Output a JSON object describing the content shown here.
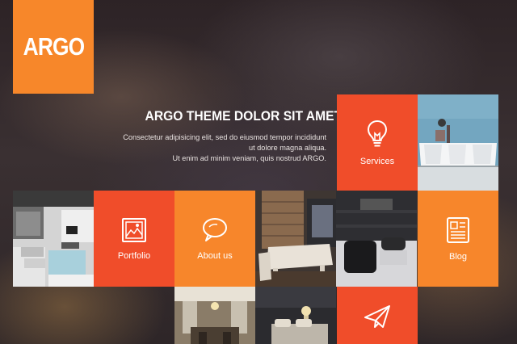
{
  "brand": {
    "logo_text": "ARGO"
  },
  "hero": {
    "title": "ARGO THEME DOLOR SIT AMET TELASDE",
    "lines": [
      "Consectetur adipisicing elit, sed do eiusmod tempor incididunt",
      "ut dolore magna aliqua.",
      "Ut enim ad minim veniam, quis nostrud ARGO."
    ]
  },
  "tiles": {
    "services": {
      "label": "Services",
      "icon": "lightbulb-icon"
    },
    "portfolio": {
      "label": "Portfolio",
      "icon": "picture-frame-icon"
    },
    "about": {
      "label": "About us",
      "icon": "speech-bubble-icon"
    },
    "blog": {
      "label": "Blog",
      "icon": "document-icon"
    },
    "contact": {
      "icon": "paper-plane-icon"
    }
  },
  "colors": {
    "accent_orange": "#f7862b",
    "accent_red": "#f04d2a"
  }
}
